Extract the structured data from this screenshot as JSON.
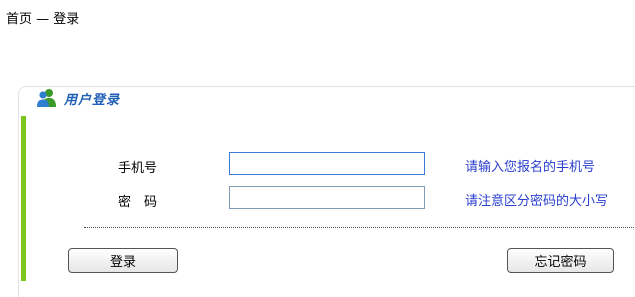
{
  "breadcrumb": "首页 — 登录",
  "panel": {
    "title": "用户登录",
    "icon": "users-icon"
  },
  "form": {
    "phone_label": "手机号",
    "phone_value": "",
    "phone_hint": "请输入您报名的手机号",
    "password_label": "密　码",
    "password_value": "",
    "password_hint": "请注意区分密码的大小写"
  },
  "buttons": {
    "login": "登录",
    "forgot": "忘记密码"
  },
  "colors": {
    "title_blue": "#1f5fb5",
    "hint_blue": "#2a3fd0",
    "accent_green": "#7dc61e"
  }
}
